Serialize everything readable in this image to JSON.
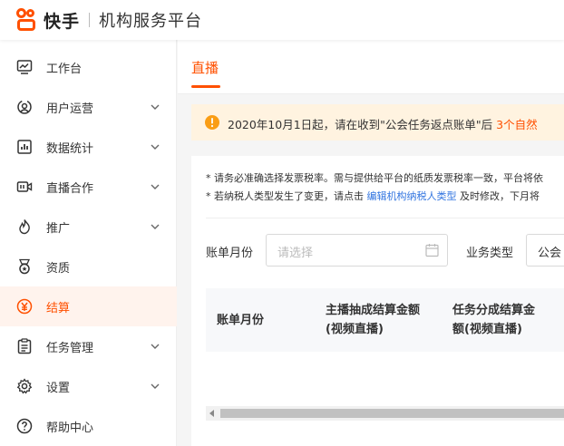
{
  "app": {
    "logo_text": "快手",
    "subtitle": "机构服务平台"
  },
  "sidebar": {
    "items": [
      {
        "label": "工作台",
        "icon": "dashboard-icon",
        "has_children": false
      },
      {
        "label": "用户运营",
        "icon": "user-ops-icon",
        "has_children": true
      },
      {
        "label": "数据统计",
        "icon": "bar-chart-icon",
        "has_children": true
      },
      {
        "label": "直播合作",
        "icon": "live-camera-icon",
        "has_children": true
      },
      {
        "label": "推广",
        "icon": "flame-icon",
        "has_children": true
      },
      {
        "label": "资质",
        "icon": "medal-icon",
        "has_children": false
      },
      {
        "label": "结算",
        "icon": "yuan-icon",
        "has_children": false,
        "active": true
      },
      {
        "label": "任务管理",
        "icon": "clipboard-icon",
        "has_children": true
      },
      {
        "label": "设置",
        "icon": "gear-icon",
        "has_children": true
      },
      {
        "label": "帮助中心",
        "icon": "help-icon",
        "has_children": false
      }
    ]
  },
  "main": {
    "tab": "直播",
    "notice": {
      "text": "2020年10月1日起，请在收到\"公会任务返点账单\"后 ",
      "highlight": "3个自然"
    },
    "tips": {
      "line1": "* 请务必准确选择发票税率。需与提供给平台的纸质发票税率一致，平台将依",
      "line2_prefix": "* 若纳税人类型发生了变更，请点击 ",
      "line2_link": "编辑机构纳税人类型",
      "line2_suffix": " 及时修改，下月将"
    },
    "filters": {
      "month_label": "账单月份",
      "month_placeholder": "请选择",
      "biz_label": "业务类型",
      "biz_value": "公会"
    },
    "table": {
      "columns": [
        {
          "line1": "账单月份",
          "line2": ""
        },
        {
          "line1": "主播抽成结算金额",
          "line2": "(视频直播)"
        },
        {
          "line1": "任务分成结算金",
          "line2": "额(视频直播)"
        }
      ]
    }
  },
  "colors": {
    "accent": "#ff5000",
    "notice_bg": "#fff3e0",
    "link": "#3275e0",
    "active_bg": "#fff3ed"
  }
}
